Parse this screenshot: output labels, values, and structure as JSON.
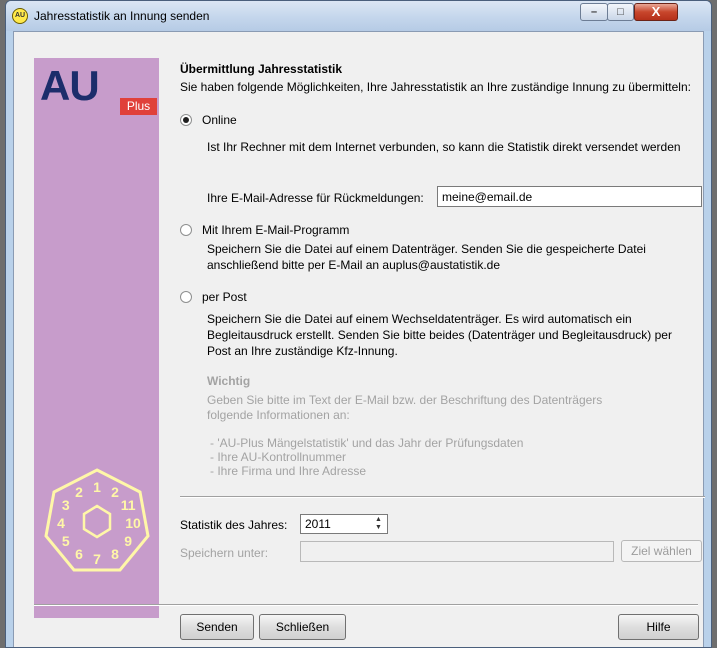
{
  "window": {
    "title": "Jahresstatistik an Innung senden",
    "app_icon_text": "AU",
    "controls": {
      "minimize": "–",
      "maximize": "□",
      "close": "X"
    }
  },
  "sidebar": {
    "logo_main": "AU",
    "logo_badge": "Plus",
    "seal_digits": [
      "1",
      "2",
      "11",
      "10",
      "9",
      "8",
      "7",
      "6",
      "5",
      "4",
      "3",
      "2"
    ]
  },
  "header": {
    "title": "Übermittlung Jahresstatistik",
    "subtitle": "Sie haben folgende Möglichkeiten, Ihre Jahresstatistik an Ihre zuständige Innung zu übermitteln:"
  },
  "options": {
    "online": {
      "label": "Online",
      "checked": true,
      "desc": "Ist Ihr Rechner mit dem Internet verbunden, so kann die Statistik direkt versendet werden",
      "email_label": "Ihre E-Mail-Adresse für Rückmeldungen:",
      "email_value": "meine@email.de"
    },
    "email_program": {
      "label": "Mit Ihrem E-Mail-Programm",
      "checked": false,
      "desc_line1": "Speichern Sie die Datei auf einem Datenträger. Senden Sie die  gespeicherte Datei",
      "desc_line2": "anschließend bitte per E-Mail an auplus@austatistik.de"
    },
    "post": {
      "label": "per Post",
      "checked": false,
      "desc_line1": "Speichern Sie die Datei auf einem Wechseldatenträger. Es wird automatisch ein",
      "desc_line2": "Begleitausdruck erstellt. Senden Sie bitte beides (Datenträger und Begleitausdruck) per",
      "desc_line3": "Post an Ihre zuständige Kfz-Innung."
    }
  },
  "important": {
    "heading": "Wichtig",
    "line1": "Geben Sie bitte im Text der E-Mail bzw. der Beschriftung des Datenträgers",
    "line2": "folgende Informationen an:",
    "items": [
      "- 'AU-Plus Mängelstatistik' und das Jahr der Prüfungsdaten",
      "- Ihre AU-Kontrollnummer",
      "- Ihre Firma und Ihre Adresse"
    ]
  },
  "year": {
    "label": "Statistik des Jahres:",
    "value": "2011"
  },
  "save": {
    "label": "Speichern unter:",
    "value": "",
    "button": "Ziel wählen"
  },
  "buttons": {
    "send": "Senden",
    "close": "Schließen",
    "help": "Hilfe"
  }
}
